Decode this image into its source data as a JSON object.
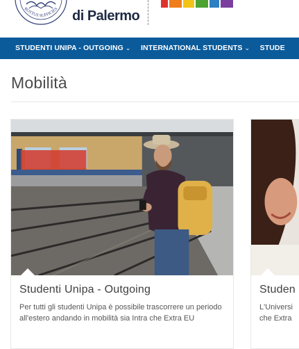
{
  "header": {
    "university_name": "di Palermo",
    "seal_motto": "ROTTUS SUFFICIES"
  },
  "nav": {
    "items": [
      {
        "label": "STUDENTI UNIPA - OUTGOING"
      },
      {
        "label": "INTERNATIONAL STUDENTS"
      },
      {
        "label": "STUDE"
      }
    ]
  },
  "page": {
    "title": "Mobilità"
  },
  "cards": [
    {
      "title": "Studenti Unipa - Outgoing",
      "description": "Per tutti gli studenti Unipa è possibile trascorrere un periodo all'estero andando in mobilità sia Intra che Extra EU"
    },
    {
      "title": "Studen",
      "description_line1": "L'Universi",
      "description_line2": "che Extra"
    }
  ],
  "colors": {
    "nav_background": "#0b5b9b",
    "nav_text": "#ffffff",
    "title_text": "#4a4a4a"
  },
  "icons": {
    "nav_chevron": "chevron-down-icon"
  }
}
